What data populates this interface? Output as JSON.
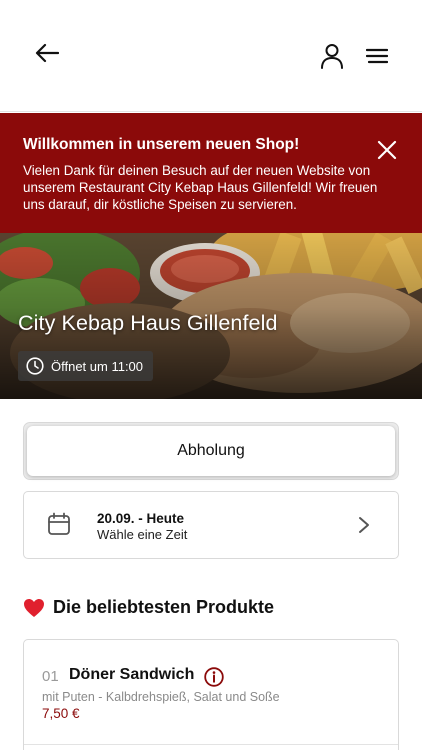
{
  "header": {
    "back_icon": "arrow-left-icon",
    "user_icon": "user-icon",
    "menu_icon": "hamburger-menu-icon"
  },
  "banner": {
    "title": "Willkommen in unserem neuen Shop!",
    "text": "Vielen Dank für deinen Besuch auf der neuen Website von unserem Restaurant City Kebap Haus Gillenfeld! Wir freuen uns darauf, dir köstliche Speisen zu servieren.",
    "close_icon": "close-icon",
    "background_color": "#8b0a0a"
  },
  "hero": {
    "restaurant_name": "City Kebap Haus Gillenfeld",
    "status": "Öffnet um 11:00",
    "status_icon": "clock-icon"
  },
  "order_mode": {
    "label": "Abholung"
  },
  "date_selector": {
    "date": "20.09. - Heute",
    "subtitle": "Wähle eine Zeit",
    "icon": "calendar-icon",
    "chevron": "chevron-right-icon"
  },
  "popular": {
    "title": "Die beliebtesten Produkte",
    "icon": "heart-icon",
    "products": [
      {
        "number": "01",
        "name": "Döner Sandwich",
        "description": "mit Puten - Kalbdrehspieß, Salat und Soße",
        "price": "7,50 €"
      }
    ]
  },
  "colors": {
    "accent": "#8b0a0a",
    "border": "#d9d9d9"
  }
}
